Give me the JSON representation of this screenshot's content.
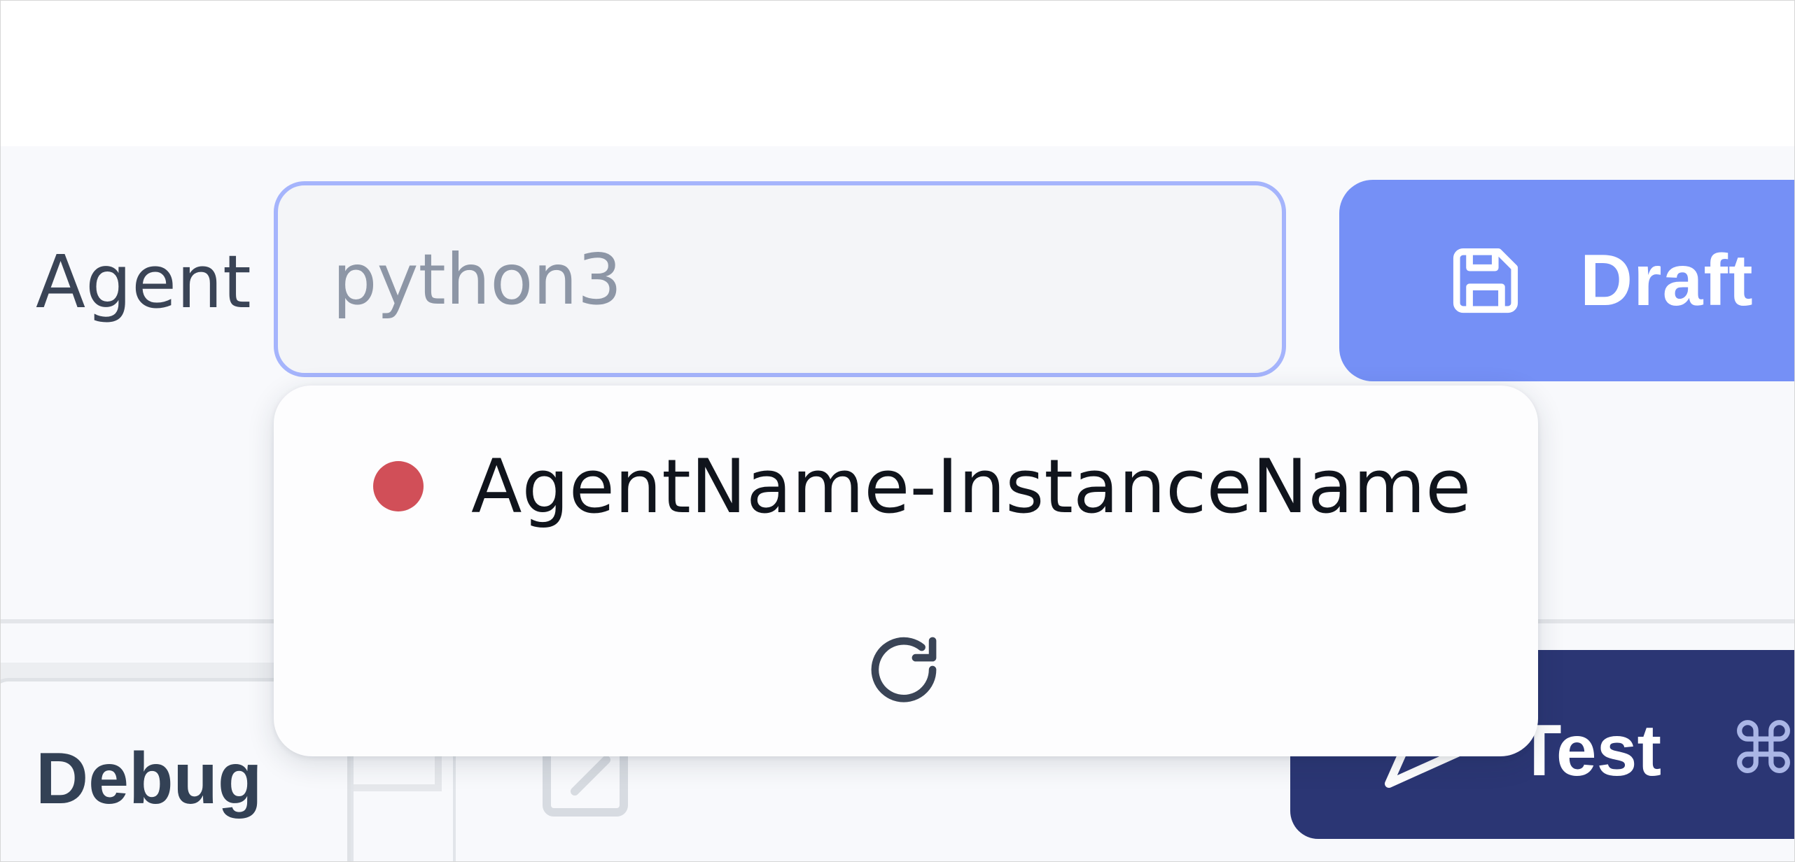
{
  "agent": {
    "label": "Agent",
    "placeholder": "python3",
    "value": ""
  },
  "toolbar": {
    "draft_label": "Draft",
    "draft_icon": "floppy-disk-icon",
    "test_label": "Test",
    "test_icon": "send-icon",
    "shortcut_label": "⌘",
    "edit_icon": "edit-icon"
  },
  "tabs": {
    "debug_label": "Debug"
  },
  "dropdown": {
    "items": [
      {
        "label": "AgentName-InstanceName",
        "status_color": "#d14f58",
        "status_icon": "status-dot-icon"
      }
    ],
    "refresh_icon": "refresh-icon"
  },
  "colors": {
    "draft_button": "#7590f6",
    "test_button": "#2b3674",
    "input_focus_border": "#a5b4fc",
    "status_offline": "#d14f58"
  }
}
